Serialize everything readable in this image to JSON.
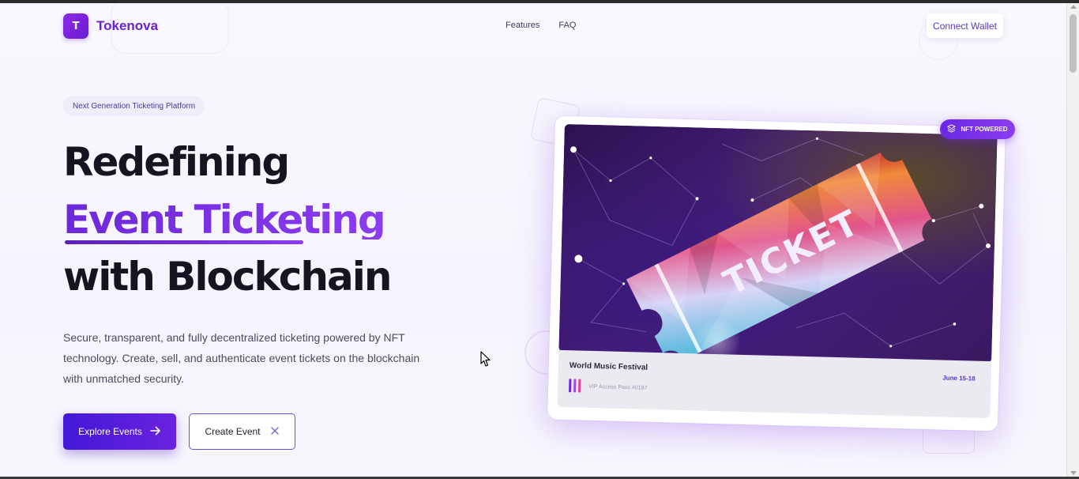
{
  "header": {
    "logo_letter": "T",
    "brand": "Tokenova",
    "nav": [
      {
        "label": "Features"
      },
      {
        "label": "FAQ"
      }
    ],
    "connect_wallet": "Connect Wallet"
  },
  "hero": {
    "badge": "Next Generation Ticketing Platform",
    "title_line1": "Redefining",
    "title_line2": "Event Ticketing",
    "title_line3": "with Blockchain",
    "description": "Secure, transparent, and fully decentralized ticketing powered by NFT technology. Create, sell, and authenticate event tickets on the blockchain with unmatched security.",
    "primary_button": "Explore Events",
    "secondary_button": "Create Event"
  },
  "card": {
    "nft_badge": "NFT POWERED",
    "ticket_word": "TICKET",
    "event_name": "World Music Festival",
    "event_date": "June 15-18",
    "pass_label": "VIP Access Pass #0187"
  },
  "colors": {
    "brand": "#6b22d6",
    "accent_gradient_start": "#4318d6",
    "accent_gradient_end": "#8b3cf0",
    "heading": "#151522",
    "pass_bar_colors": [
      "#6a28e4",
      "#9b4cf0",
      "#e0459b"
    ]
  },
  "icons": {
    "primary_button_icon": "arrow-right-icon",
    "secondary_button_icon": "sparkle-icon",
    "nft_badge_icon": "layers-icon"
  }
}
